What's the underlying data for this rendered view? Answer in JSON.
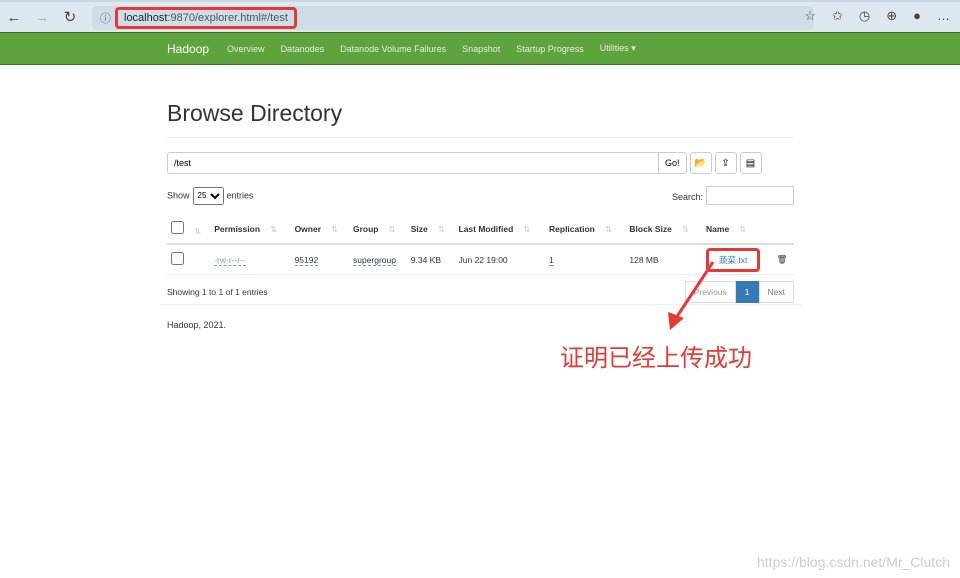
{
  "browser": {
    "url_host": "localhost",
    "url_rest": ":9870/explorer.html#/test"
  },
  "navbar": {
    "brand": "Hadoop",
    "items": [
      "Overview",
      "Datanodes",
      "Datanode Volume Failures",
      "Snapshot",
      "Startup Progress",
      "Utilities ▾"
    ]
  },
  "page": {
    "title": "Browse Directory",
    "path": "/test",
    "go": "Go!",
    "show": "Show",
    "entries_value": "25",
    "entries": "entries",
    "search": "Search:"
  },
  "table": {
    "headers": [
      "Permission",
      "Owner",
      "Group",
      "Size",
      "Last Modified",
      "Replication",
      "Block Size",
      "Name"
    ],
    "rows": [
      {
        "permission": "-rw-r--r--",
        "owner": "95192",
        "group": "supergroup",
        "size": "9.34 KB",
        "modified": "Jun 22 19:00",
        "replication": "1",
        "block": "128 MB",
        "name": "蔬菜.txt"
      }
    ]
  },
  "footer": {
    "info": "Showing 1 to 1 of 1 entries",
    "prev": "Previous",
    "page": "1",
    "next": "Next",
    "copyright": "Hadoop, 2021."
  },
  "annotation": "证明已经上传成功",
  "watermark": "https://blog.csdn.net/Mr_Clutch"
}
